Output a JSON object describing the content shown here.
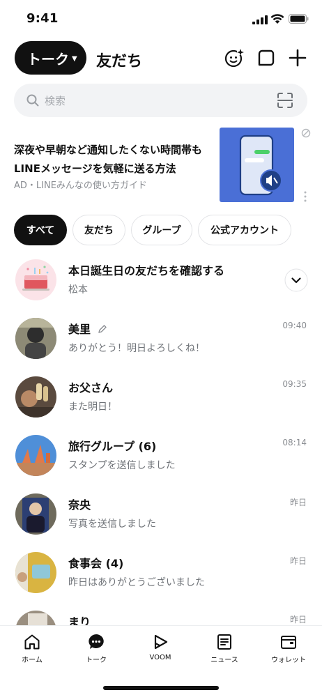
{
  "status_bar": {
    "time": "9:41"
  },
  "header": {
    "talk_label": "トーク",
    "friends_label": "友だち"
  },
  "search": {
    "placeholder": "検索"
  },
  "ad": {
    "title": "深夜や早朝など通知したくない時間帯もLINEメッセージを気軽に送る方法",
    "sponsor": "AD・LINEみんなの使い方ガイド"
  },
  "filters": [
    {
      "label": "すべて",
      "active": true
    },
    {
      "label": "友だち",
      "active": false
    },
    {
      "label": "グループ",
      "active": false
    },
    {
      "label": "公式アカウント",
      "active": false
    }
  ],
  "birthday": {
    "title": "本日誕生日の友だちを確認する",
    "subtitle": "松本"
  },
  "chats": [
    {
      "name": "美里",
      "message": "ありがとう！明日よろしくね！",
      "time": "09:40",
      "avatar_color": "#6b6f63"
    },
    {
      "name": "お父さん",
      "message": "また明日！",
      "time": "09:35",
      "avatar_color": "#8a6a4e"
    },
    {
      "name": "旅行グループ (6)",
      "message": "スタンプを送信しました",
      "time": "08:14",
      "avatar_color": "#4f8fd8"
    },
    {
      "name": "奈央",
      "message": "写真を送信しました",
      "time": "昨日",
      "avatar_color": "#3b3f6e"
    },
    {
      "name": "食事会 (4)",
      "message": "昨日はありがとうございました",
      "time": "昨日",
      "avatar_color": "#d9b441"
    },
    {
      "name": "まり",
      "message": "",
      "time": "昨日",
      "avatar_color": "#9a8f80"
    }
  ],
  "tabs": [
    {
      "label": "ホーム",
      "icon": "home-icon"
    },
    {
      "label": "トーク",
      "icon": "talk-icon"
    },
    {
      "label": "VOOM",
      "icon": "voom-icon"
    },
    {
      "label": "ニュース",
      "icon": "news-icon"
    },
    {
      "label": "ウォレット",
      "icon": "wallet-icon"
    }
  ]
}
